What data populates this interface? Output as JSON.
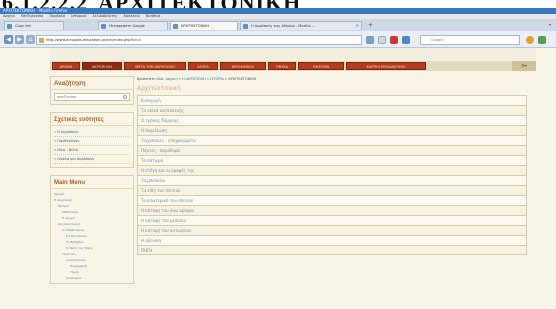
{
  "doc_heading": {
    "number": "6.1.2.2.2",
    "title": "ΑΡΧΙΤΕΚΤΟΝΙΚΗ"
  },
  "window": {
    "title": "ΑΡΧΙΤΕΚΤΟΝΙΚΗ - Mozilla Firefox"
  },
  "menubar": [
    "Αρχείο",
    "Επεξεργασία",
    "Προβολή",
    "Ιστορικό",
    "Σελιδοδείκτες",
    "Εργαλεία",
    "Βοήθεια"
  ],
  "tabs": [
    {
      "label": "Copy link"
    },
    {
      "label": "Μεταφράστε Google"
    },
    {
      "label": "ΑΡΧΙΤΕΚΤΟΝΙΚΗ"
    },
    {
      "label": "Η Ακρόπολη των Αθηνών - Mozilla ..."
    }
  ],
  "browser": {
    "url": "http://www.acropolis-education.gr/ark/index.php?id=4",
    "search_placeholder": "Google"
  },
  "topnav": [
    "ΑΡΧΙΚΗ",
    "ΑΚΡΟΠΟΛΗ",
    "ΜΕΤΑ ΤΗΝ ΑΚΡΟΠΟΛΗ",
    "ΑΓΟΡΑ",
    "ΚΕΡΑΜΕΙΚΟΣ",
    "ΠΝΥΚΑ",
    "ΘΗΣΕΙΟΝ",
    "ΚΑΡΠΟΙ ΕΚΠΑΙΔΕΥΣΗΣ"
  ],
  "sidebar": {
    "search_title": "Αναζήτηση",
    "search_value": "αναζήτηση",
    "related_title": "Σχετικές ενότητες",
    "related": [
      "Η Ακρόπολη",
      "Παρθενώνας",
      "Νίκη - Βίλια",
      "Ομάδα για Ακρόπολη"
    ],
    "menu_title": "Main Menu",
    "menu": [
      "Αρχική",
      "Η Ακρόπολη",
      "Ιστορία",
      "Μυθολογία",
      "Η Αγορά",
      "Αρχιτεκτονική",
      "Ο Παρθενώνας",
      "Τα Προπύλαια",
      "Το Ερέχθειο",
      "Ο Ναός της Νίκης",
      "Γλυπτική",
      "Αναστήλωση",
      "Ζωγραφική",
      "Τέχνη",
      "Σύνδεσμοι"
    ]
  },
  "content": {
    "breadcrumb_prefix": "Βρίσκεστε εδώ:",
    "breadcrumb_home": "Αρχική",
    "breadcrumb_section": "Η ΑΚΡΟΠΟΛΗ",
    "breadcrumb_sub": "ΙΣΤΟΡΙΑ",
    "breadcrumb_current": "ΑΡΧΙΤΕΚΤΟΝΙΚΗ",
    "title": "Αρχιτεκτονική",
    "sections": [
      "Εισαγωγή",
      "Τα υλικά κατασκευής",
      "Ο τρόπος δόμησης",
      "Η θεμελίωση",
      "Τοιχοποιίες - υποχρεώματα",
      "Πόρτες - παράθυρα",
      "Το πάτωμα",
      "Η στέγη και οι οροφές της",
      "Το μπαλκόνι",
      "Τα είδη του σπιτιού",
      "Το εσωτερικό του σπιτιού",
      "Η κάτοψη του άνω ορόφου",
      "Η κάτοψη του μεσαίου",
      "Η κάτοψη του κατωγείου",
      "Η αξονική",
      "ΠΗΓΗ"
    ]
  }
}
